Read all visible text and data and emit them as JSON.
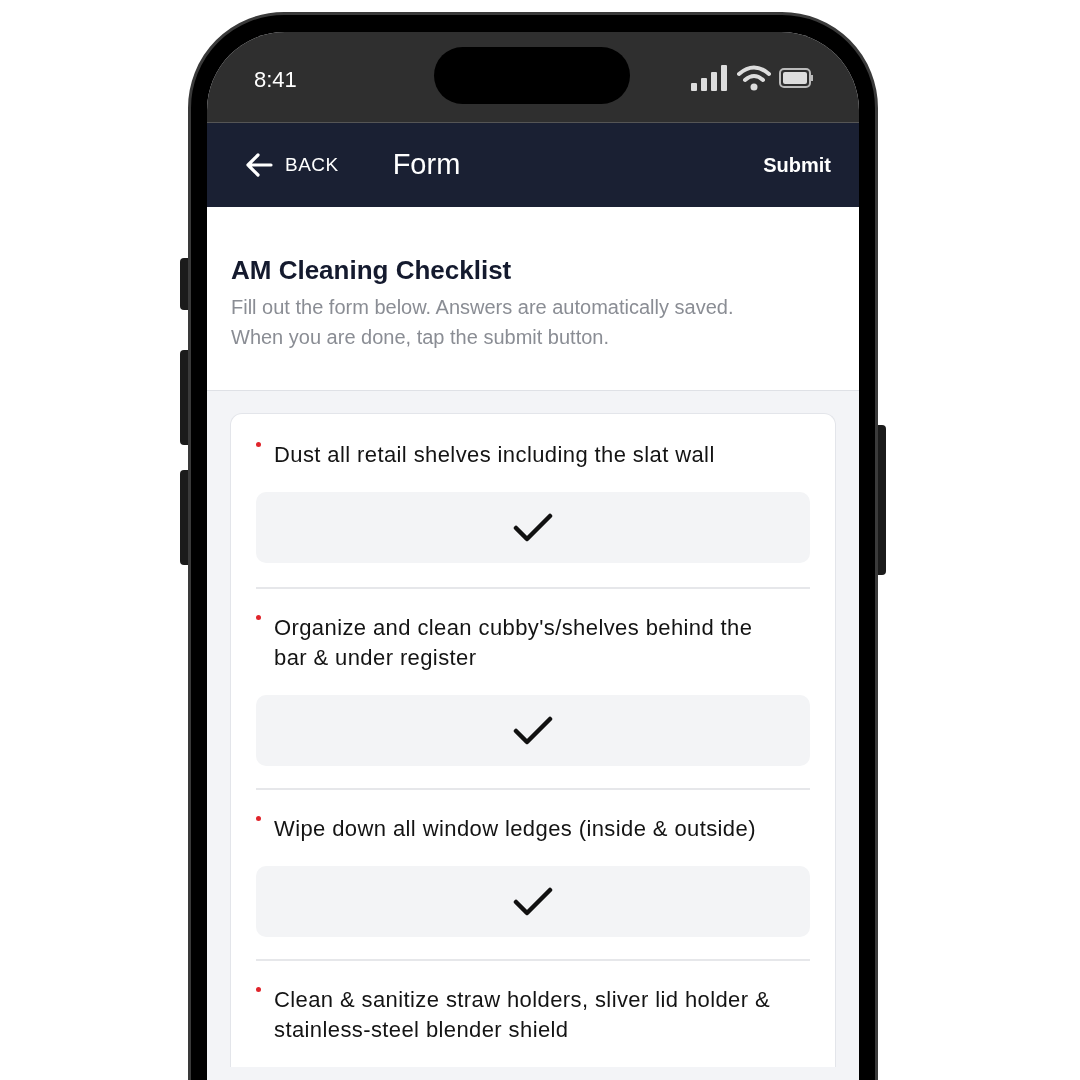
{
  "status_bar": {
    "time": "8:41"
  },
  "header": {
    "back": "BACK",
    "title": "Form",
    "submit": "Submit"
  },
  "intro": {
    "title": "AM Cleaning Checklist",
    "description": "Fill out the form below. Answers are automatically saved. When you are done, tap the submit button."
  },
  "questions": [
    {
      "text": "Dust all retail shelves including the slat wall",
      "required": true,
      "checked": true
    },
    {
      "text": "Organize and clean cubby's/shelves behind the bar & under register",
      "required": true,
      "checked": true
    },
    {
      "text": "Wipe down all window ledges (inside & outside)",
      "required": true,
      "checked": true
    },
    {
      "text": "Clean & sanitize straw holders, sliver lid holder & stainless-steel blender shield",
      "required": true
    }
  ]
}
